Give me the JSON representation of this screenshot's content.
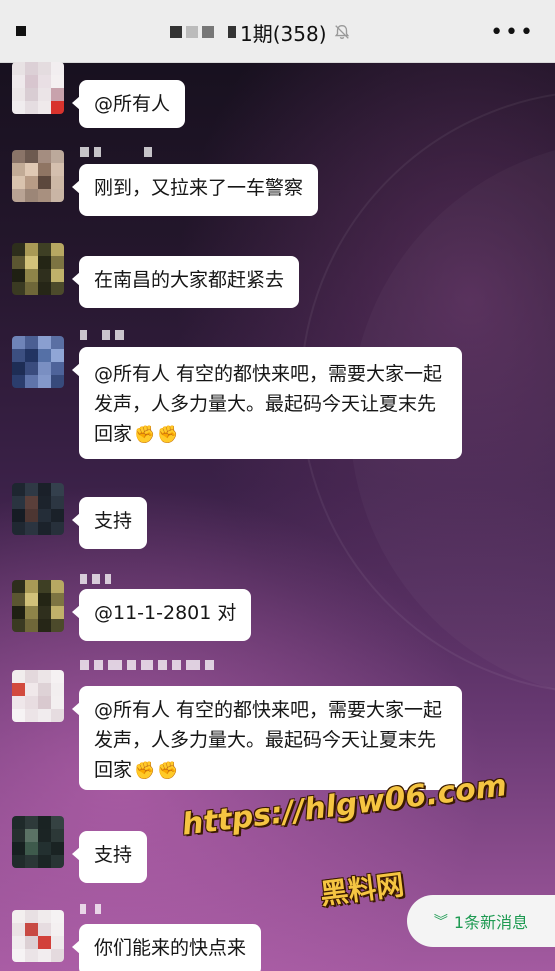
{
  "header": {
    "title": "1期(358)",
    "more_label": "•••",
    "back_label": "‹"
  },
  "messages": [
    {
      "text": "@所有人"
    },
    {
      "text": "刚到，又拉来了一车警察"
    },
    {
      "text": "在南昌的大家都赶紧去"
    },
    {
      "text": "@所有人 有空的都快来吧，需要大家一起发声，人多力量大。最起码今天让夏末先回家"
    },
    {
      "text": "支持"
    },
    {
      "text": "@11-1-2801 对"
    },
    {
      "text": "@所有人 有空的都快来吧，需要大家一起发声，人多力量大。最起码今天让夏末先回家"
    },
    {
      "text": "支持"
    },
    {
      "text": "你们能来的快点来"
    }
  ],
  "emoji": "✊",
  "new_messages": {
    "label": "1条新消息",
    "icon": "double-chevron-down-icon"
  },
  "watermark": {
    "url": "https://hlgw06.com",
    "text": "黑料网"
  },
  "colors": {
    "header_bg": "#ededed",
    "accent_green": "#1e9a52",
    "bubble_bg": "#ffffff",
    "watermark": "#f5c542"
  }
}
